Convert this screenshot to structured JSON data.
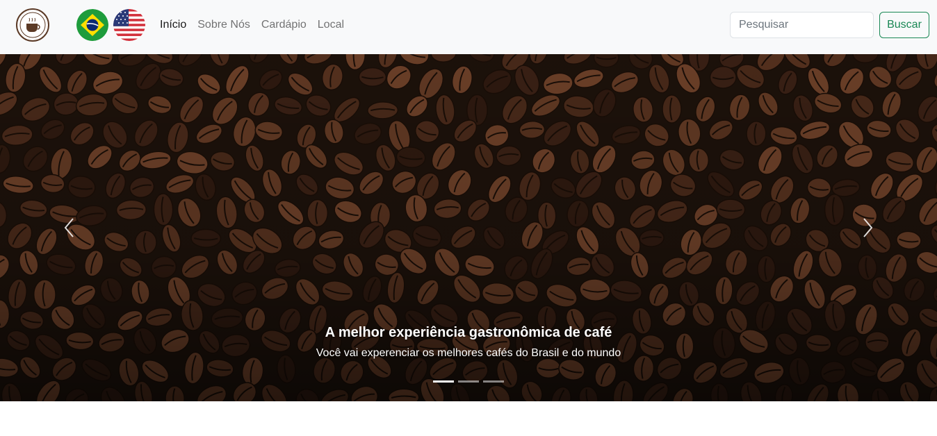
{
  "navbar": {
    "logo_icon": "coffee-logo-icon",
    "flags": [
      {
        "name": "brazil-flag-icon",
        "colors": {
          "green": "#1e9c3c",
          "yellow": "#fedf00",
          "blue": "#0c2a73"
        }
      },
      {
        "name": "usa-flag-icon",
        "colors": {
          "red": "#d22f3a",
          "white": "#ffffff",
          "blue": "#2b3a78"
        }
      }
    ],
    "links": [
      {
        "label": "Início",
        "active": true
      },
      {
        "label": "Sobre Nós",
        "active": false
      },
      {
        "label": "Cardápio",
        "active": false
      },
      {
        "label": "Local",
        "active": false
      }
    ],
    "search": {
      "placeholder": "Pesquisar",
      "value": "",
      "button_label": "Buscar"
    }
  },
  "carousel": {
    "caption_title": "A melhor experiência gastronômica de café",
    "caption_text": "Você vai experenciar os melhores cafés do Brasil e do mundo",
    "prev_icon": "chevron-left-icon",
    "next_icon": "chevron-right-icon",
    "slide_count": 3,
    "active_slide": 1
  },
  "colors": {
    "navbar_bg": "#f8f9fa",
    "accent_green": "#198754",
    "coffee_dark": "#1d120b",
    "coffee_bean": "#5a3220"
  }
}
